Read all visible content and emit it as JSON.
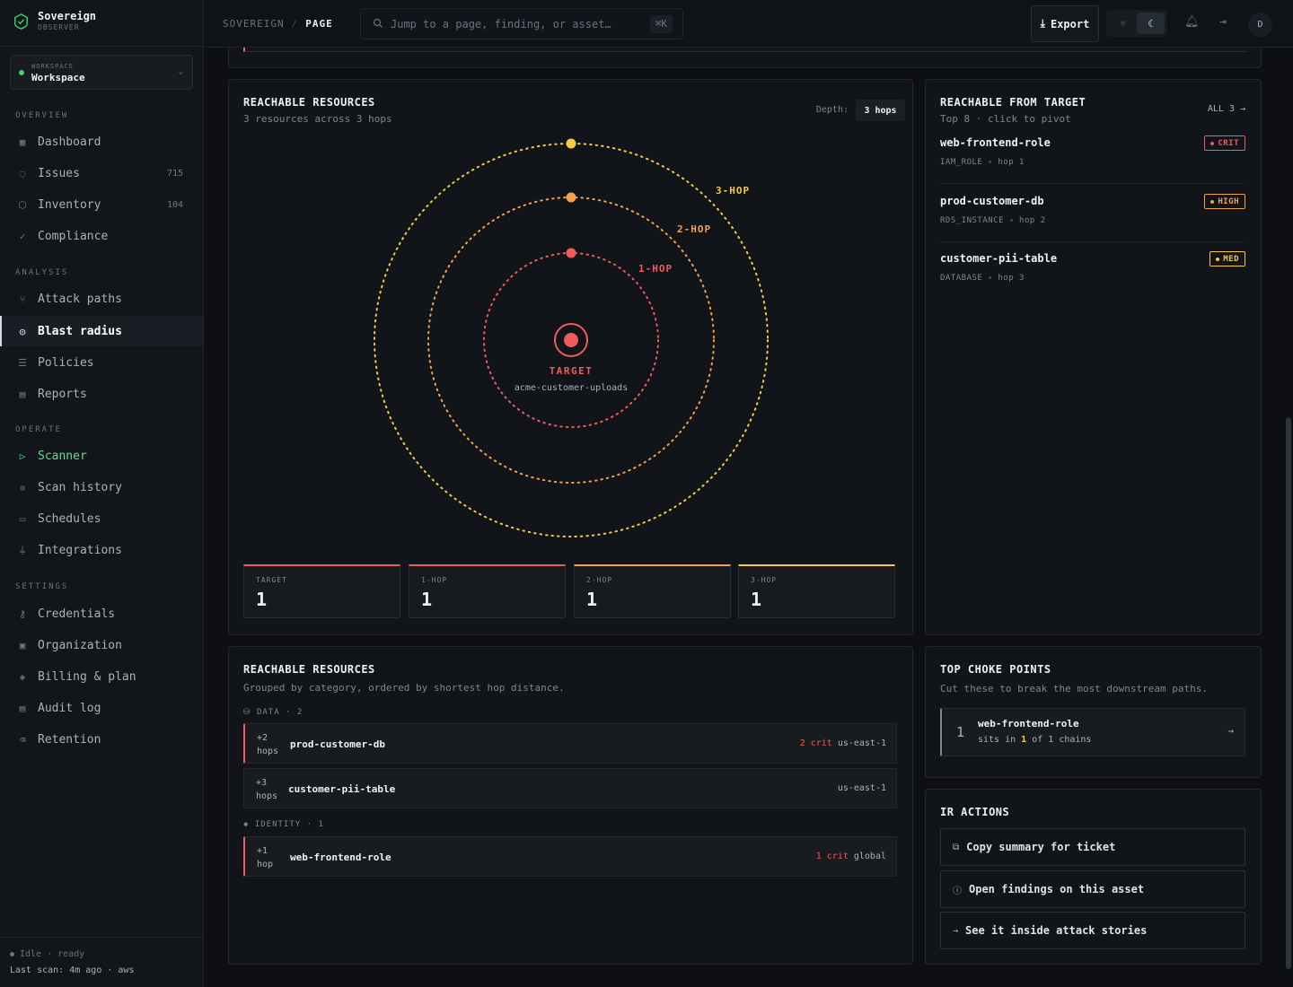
{
  "brand": {
    "name": "Sovereign",
    "sub": "OBSERVER"
  },
  "workspace": {
    "label": "WORKSPACE",
    "name": "Workspace"
  },
  "nav": {
    "overview": "OVERVIEW",
    "analysis": "ANALYSIS",
    "operate": "OPERATE",
    "settings": "SETTINGS",
    "dashboard": "Dashboard",
    "issues": "Issues",
    "issues_count": "715",
    "inventory": "Inventory",
    "inventory_count": "104",
    "compliance": "Compliance",
    "attack_paths": "Attack paths",
    "blast_radius": "Blast radius",
    "policies": "Policies",
    "reports": "Reports",
    "scanner": "Scanner",
    "scan_history": "Scan history",
    "schedules": "Schedules",
    "integrations": "Integrations",
    "credentials": "Credentials",
    "organization": "Organization",
    "billing": "Billing & plan",
    "audit_log": "Audit log",
    "retention": "Retention"
  },
  "footer": {
    "status": "Idle · ready",
    "last_scan": "Last scan: 4m ago · aws"
  },
  "topbar": {
    "crumb_root": "SOVEREIGN",
    "crumb_sep": "/",
    "crumb_current": "PAGE",
    "search_placeholder": "Jump to a page, finding, or asset…",
    "search_kbd": "⌘K",
    "export_label": "Export",
    "avatar_initial": "D"
  },
  "blast": {
    "title": "REACHABLE RESOURCES",
    "subtitle": "3 resources across 3 hops",
    "depth_label": "Depth:",
    "depth_value": "3 hops",
    "target_label": "TARGET",
    "target_name": "acme-customer-uploads",
    "rings": [
      {
        "label": "1-HOP",
        "color": "#f05b5b"
      },
      {
        "label": "2-HOP",
        "color": "#f4a14b"
      },
      {
        "label": "3-HOP",
        "color": "#f7c948"
      }
    ],
    "stats": [
      {
        "label": "TARGET",
        "value": "1",
        "color": "#f05b5b"
      },
      {
        "label": "1-HOP",
        "value": "1",
        "color": "#f05b5b"
      },
      {
        "label": "2-HOP",
        "value": "1",
        "color": "#f4a14b"
      },
      {
        "label": "3-HOP",
        "value": "1",
        "color": "#f7c948"
      }
    ]
  },
  "reachable_from": {
    "title": "REACHABLE FROM TARGET",
    "subtitle": "Top 8 · click to pivot",
    "more": "ALL 3 →",
    "items": [
      {
        "name": "web-frontend-role",
        "type": "IAM_ROLE",
        "hop": "hop 1",
        "sev": "CRIT",
        "sev_color": "#f05b5b"
      },
      {
        "name": "prod-customer-db",
        "type": "RDS_INSTANCE",
        "hop": "hop 2",
        "sev": "HIGH",
        "sev_color": "#f4a14b"
      },
      {
        "name": "customer-pii-table",
        "type": "DATABASE",
        "hop": "hop 3",
        "sev": "MED",
        "sev_color": "#f7c948"
      }
    ]
  },
  "resources": {
    "title": "REACHABLE RESOURCES",
    "subtitle": "Grouped by category, ordered by shortest hop distance.",
    "data_label": "⛁ DATA · 2",
    "identity_label": "◆ IDENTITY · 1",
    "rows": [
      {
        "hops_a": "+2",
        "hops_b": "hops",
        "name": "prod-customer-db",
        "crit": "2 crit",
        "region": "us-east-1"
      },
      {
        "hops_a": "+3",
        "hops_b": "hops",
        "name": "customer-pii-table",
        "crit": "",
        "region": "us-east-1"
      },
      {
        "hops_a": "+1",
        "hops_b": "hop",
        "name": "web-frontend-role",
        "crit": "1 crit",
        "region": "global"
      }
    ]
  },
  "choke": {
    "title": "TOP CHOKE POINTS",
    "subtitle": "Cut these to break the most downstream paths.",
    "rank": "1",
    "name": "web-frontend-role",
    "sits_pre": "sits in ",
    "sits_n": "1",
    "sits_post": " of 1 chains"
  },
  "ir": {
    "title": "IR ACTIONS",
    "copy": "Copy summary for ticket",
    "open": "Open findings on this asset",
    "see": "See it inside attack stories"
  }
}
